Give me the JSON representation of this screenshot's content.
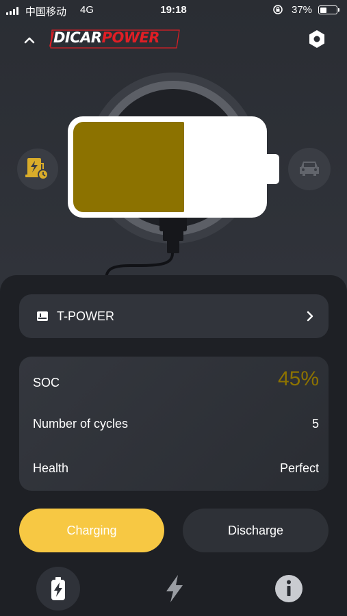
{
  "status_bar": {
    "carrier": "中国移动",
    "network": "4G",
    "time": "19:18",
    "battery_percent": "37%"
  },
  "header": {
    "brand_part1": "DICAR",
    "brand_part2": "POWER",
    "brand_colors": {
      "primary": "#ffffff",
      "accent": "#e01e25"
    }
  },
  "battery_visual": {
    "fill_fraction": 0.59,
    "fill_color": "#8c7200",
    "left_icon": "charger-station-icon",
    "right_icon": "car-icon"
  },
  "device": {
    "icon": "device-icon",
    "name": "T-POWER"
  },
  "stats": {
    "soc_label": "SOC",
    "soc_value": "45%",
    "cycles_label": "Number of cycles",
    "cycles_value": "5",
    "health_label": "Health",
    "health_value": "Perfect"
  },
  "actions": {
    "charging_label": "Charging",
    "discharge_label": "Discharge",
    "active_color": "#f7c843"
  },
  "tabs": [
    {
      "icon": "battery-bolt-icon",
      "active": true
    },
    {
      "icon": "lightning-icon",
      "active": false
    },
    {
      "icon": "info-icon",
      "active": false
    }
  ]
}
